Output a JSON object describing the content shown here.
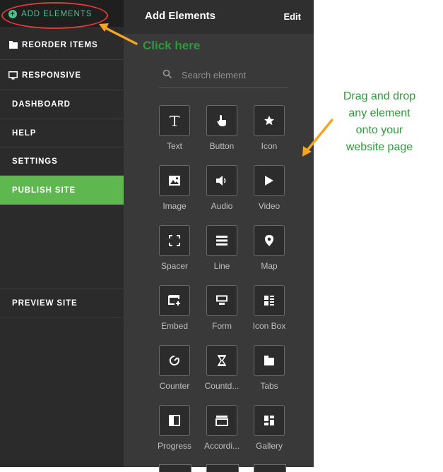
{
  "sidebar": {
    "add_elements": "ADD ELEMENTS",
    "reorder_items": "REORDER ITEMS",
    "responsive": "RESPONSIVE",
    "dashboard": "DASHBOARD",
    "help": "HELP",
    "settings": "SETTINGS",
    "publish_site": "PUBLISH SITE",
    "preview_site": "PREVIEW SITE"
  },
  "panel": {
    "title": "Add Elements",
    "edit_label": "Edit",
    "search_placeholder": "Search element",
    "elements": [
      {
        "label": "Text",
        "icon": "text-icon"
      },
      {
        "label": "Button",
        "icon": "pointer-hand-icon"
      },
      {
        "label": "Icon",
        "icon": "star-icon"
      },
      {
        "label": "Image",
        "icon": "image-icon"
      },
      {
        "label": "Audio",
        "icon": "speaker-icon"
      },
      {
        "label": "Video",
        "icon": "play-icon"
      },
      {
        "label": "Spacer",
        "icon": "spacer-icon"
      },
      {
        "label": "Line",
        "icon": "line-icon"
      },
      {
        "label": "Map",
        "icon": "map-pin-icon"
      },
      {
        "label": "Embed",
        "icon": "embed-icon"
      },
      {
        "label": "Form",
        "icon": "form-icon"
      },
      {
        "label": "Icon Box",
        "icon": "icon-box-icon"
      },
      {
        "label": "Counter",
        "icon": "counter-icon"
      },
      {
        "label": "Countd...",
        "icon": "hourglass-icon"
      },
      {
        "label": "Tabs",
        "icon": "tabs-icon"
      },
      {
        "label": "Progress",
        "icon": "progress-icon"
      },
      {
        "label": "Accordi...",
        "icon": "accordion-icon"
      },
      {
        "label": "Gallery",
        "icon": "gallery-icon"
      }
    ]
  },
  "annotations": {
    "click_here": "Click here",
    "drag_line1": "Drag and drop",
    "drag_line2": "any element",
    "drag_line3": "onto your",
    "drag_line4": "website page"
  },
  "colors": {
    "accent_green": "#4fc08d",
    "publish_green": "#5fb84f",
    "annotation_green": "#2e9a3a",
    "arrow_orange": "#f2a622",
    "highlight_red": "#e53935"
  }
}
